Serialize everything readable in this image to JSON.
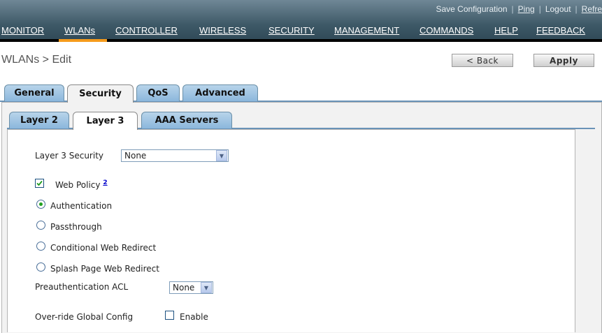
{
  "toplinks": [
    "Save Configuration",
    "Ping",
    "Logout",
    "Refre"
  ],
  "nav": [
    "MONITOR",
    "WLANs",
    "CONTROLLER",
    "WIRELESS",
    "SECURITY",
    "MANAGEMENT",
    "COMMANDS",
    "HELP",
    "FEEDBACK"
  ],
  "nav_active": "WLANs",
  "page": {
    "title": "WLANs > Edit",
    "back": "< Back",
    "apply": "Apply"
  },
  "tabs": [
    "General",
    "Security",
    "QoS",
    "Advanced"
  ],
  "tabs_active": "Security",
  "subtabs": [
    "Layer 2",
    "Layer 3",
    "AAA Servers"
  ],
  "subtabs_active": "Layer 3",
  "form": {
    "layer3_security_label": "Layer 3 Security",
    "layer3_security_value": "None",
    "web_policy_label": "Web Policy",
    "web_policy_checked": true,
    "web_policy_footnote": "2",
    "options": [
      {
        "label": "Authentication",
        "selected": true
      },
      {
        "label": "Passthrough",
        "selected": false
      },
      {
        "label": "Conditional Web Redirect",
        "selected": false
      },
      {
        "label": "Splash Page Web Redirect",
        "selected": false
      }
    ],
    "preauth_acl_label": "Preauthentication ACL",
    "preauth_acl_value": "None",
    "override_label": "Over-ride Global Config",
    "override_enable_label": "Enable",
    "override_checked": false
  },
  "colors": {
    "accent": "#f59b1b",
    "tab_blue": "#8bb7dc",
    "radio_green": "#21a121"
  }
}
